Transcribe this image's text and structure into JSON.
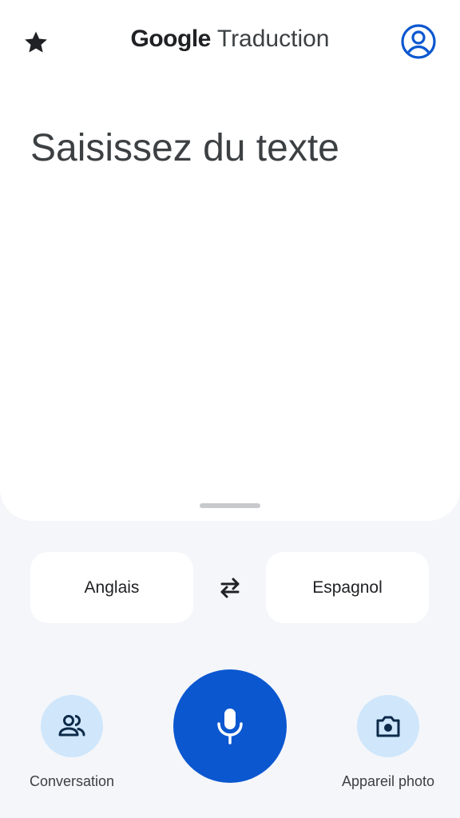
{
  "header": {
    "brand": "Google",
    "product": "Traduction"
  },
  "input": {
    "placeholder": "Saisissez du texte"
  },
  "languages": {
    "source": "Anglais",
    "target": "Espagnol"
  },
  "actions": {
    "conversation_label": "Conversation",
    "camera_label": "Appareil photo"
  },
  "icons": {
    "star": "star-icon",
    "account": "account-circle-icon",
    "swap": "swap-arrows-icon",
    "conversation": "people-icon",
    "microphone": "microphone-icon",
    "camera": "camera-icon"
  },
  "colors": {
    "accent": "#0b57d0",
    "accent_light": "#cfe6fb",
    "background": "#f4f6fa"
  }
}
